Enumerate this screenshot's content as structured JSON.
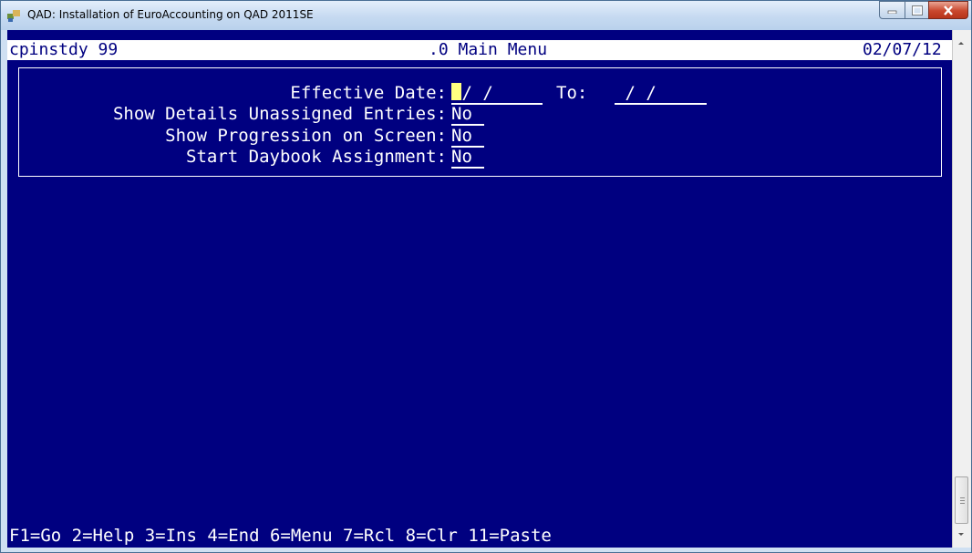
{
  "window": {
    "title": "QAD: Installation of EuroAccounting on QAD 2011SE",
    "icon": "app-icon"
  },
  "header": {
    "program": "cpinstdy 99",
    "menu": ".0 Main Menu",
    "date": "02/07/12"
  },
  "form": {
    "effective_date_label": "Effective Date:",
    "effective_date_value": " / / ",
    "to_label": "To:",
    "to_value": " / / ",
    "show_details_label": "Show Details Unassigned Entries:",
    "show_details_value": "No",
    "show_progression_label": "Show Progression on Screen:",
    "show_progression_value": "No",
    "start_daybook_label": "Start Daybook Assignment:",
    "start_daybook_value": "No"
  },
  "footer": {
    "function_keys": "F1=Go 2=Help 3=Ins 4=End 6=Menu 7=Rcl 8=Clr 11=Paste"
  },
  "colors": {
    "console_bg": "#000080",
    "text": "#ffffff",
    "cursor": "#ffff80"
  }
}
